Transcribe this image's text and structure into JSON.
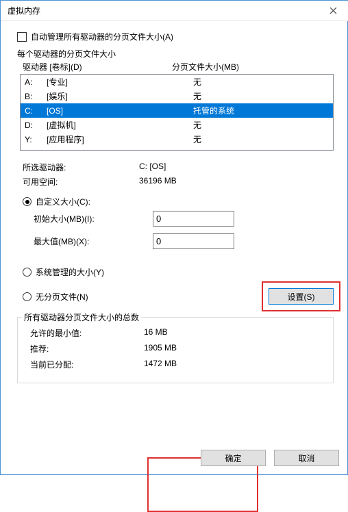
{
  "title": "虚拟内存",
  "auto_label": "自动管理所有驱动器的分页文件大小(A)",
  "each_label": "每个驱动器的分页文件大小",
  "header_drive": "驱动器 [卷标](D)",
  "header_size": "分页文件大小(MB)",
  "drives": [
    {
      "letter": "A:",
      "label": "[专业]",
      "size": "无",
      "sel": false
    },
    {
      "letter": "B:",
      "label": "[娱乐]",
      "size": "无",
      "sel": false
    },
    {
      "letter": "C:",
      "label": "[OS]",
      "size": "托管的系统",
      "sel": true
    },
    {
      "letter": "D:",
      "label": "[虚拟机]",
      "size": "无",
      "sel": false
    },
    {
      "letter": "Y:",
      "label": "[应用程序]",
      "size": "无",
      "sel": false
    }
  ],
  "selected_drive_label": "所选驱动器:",
  "selected_drive_value": "C:  [OS]",
  "avail_label": "可用空间:",
  "avail_value": "36196 MB",
  "custom_radio": "自定义大小(C):",
  "initial_label": "初始大小(MB)(I):",
  "initial_value": "0",
  "max_label": "最大值(MB)(X):",
  "max_value": "0",
  "sys_radio": "系统管理的大小(Y)",
  "none_radio": "无分页文件(N)",
  "set_btn": "设置(S)",
  "totals_title": "所有驱动器分页文件大小的总数",
  "min_label": "允许的最小值:",
  "min_value": "16 MB",
  "rec_label": "推荐:",
  "rec_value": "1905 MB",
  "cur_label": "当前已分配:",
  "cur_value": "1472 MB",
  "ok_btn": "确定",
  "cancel_btn": "取消"
}
